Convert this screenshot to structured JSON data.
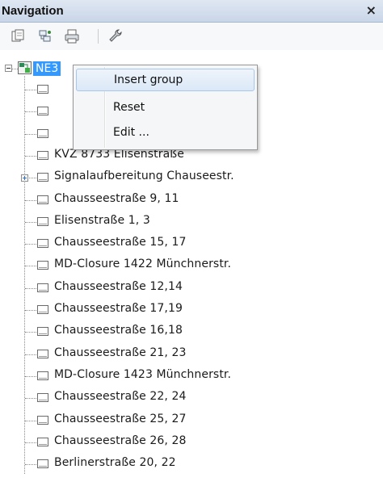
{
  "window": {
    "title": "Navigation",
    "close_glyph": "×"
  },
  "toolbar": {
    "buttons": [
      {
        "icon": "copy-icon"
      },
      {
        "icon": "tree-refresh-icon"
      },
      {
        "icon": "print-icon"
      },
      {
        "icon": "wrench-icon"
      }
    ]
  },
  "tree": {
    "root": {
      "label": "NE3",
      "icon": "network-element-icon",
      "expanded": true
    },
    "children": [
      {
        "label": ""
      },
      {
        "label": ""
      },
      {
        "label": ""
      },
      {
        "label": "KVZ 8733 Elisenstraße"
      },
      {
        "label": "Signalaufbereitung Chauseestr.",
        "expandable": true
      },
      {
        "label": "Chausseestraße  9, 11"
      },
      {
        "label": "Elisenstraße 1, 3"
      },
      {
        "label": "Chausseestraße  15, 17"
      },
      {
        "label": "MD-Closure 1422 Münchnerstr."
      },
      {
        "label": "Chausseestraße  12,14"
      },
      {
        "label": "Chausseestraße  17,19"
      },
      {
        "label": "Chausseestraße  16,18"
      },
      {
        "label": "Chausseestraße  21, 23"
      },
      {
        "label": "MD-Closure 1423 Münchnerstr."
      },
      {
        "label": "Chausseestraße  22, 24"
      },
      {
        "label": "Chausseestraße  25, 27"
      },
      {
        "label": "Chausseestraße  26, 28"
      },
      {
        "label": "Berlinerstraße 20, 22"
      }
    ]
  },
  "context_menu": {
    "items": [
      {
        "label": "Insert group",
        "highlighted": true
      },
      {
        "label": "Reset"
      },
      {
        "label": "Edit ..."
      }
    ]
  },
  "colors": {
    "selection": "#3399ff",
    "menu_highlight_border": "#a8c7ea",
    "titlebar": "#c9d6e8"
  }
}
